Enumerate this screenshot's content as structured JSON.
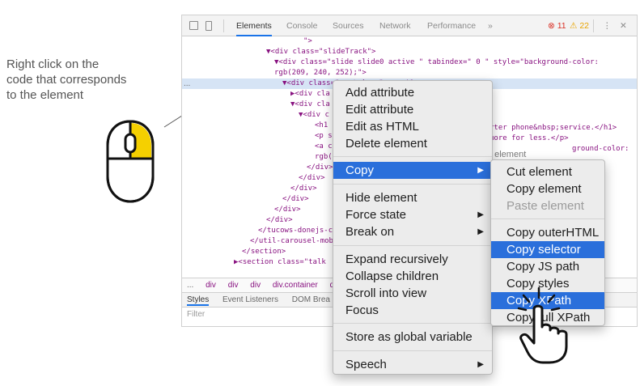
{
  "instruction": {
    "lines": [
      "Right click on the",
      "code that corresponds",
      "to the element"
    ]
  },
  "devtools": {
    "tabs": [
      "Elements",
      "Console",
      "Sources",
      "Network",
      "Performance"
    ],
    "more_tabs": "»",
    "error_count": "11",
    "warning_count": "22",
    "kebab": "⋮",
    "close": "✕",
    "code_lines": [
      "\">",
      "▼<div class=\"slideTrack\">",
      "▼<div class=\"slide slide0  active \" tabindex=\" 0 \" style=\"background-color:",
      "rgb(209, 240, 252);\">",
      "▼<div class=\"container\"> == $0",
      "▶<div cla",
      "▼<div cla",
      "▼<div c",
      "<h1",
      "<p s",
      "<a c",
      "rgb(",
      "</div>",
      "</div>",
      "</div>",
      "</div>",
      "</div>",
      "</div>",
      "</tucows-donejs-c",
      "</util-carousel-mob",
      "</section>",
      "▶<section class=\"talk"
    ],
    "right_fragments": [
      "rter phone&nbsp;service.</h1>",
      "more for less.</p>",
      "t element",
      "ground-color:"
    ],
    "selected_prefix": "...",
    "breadcrumbs": [
      "...",
      "div",
      "div",
      "div",
      "div.container",
      "div"
    ],
    "bottom_tabs": [
      "Styles",
      "Event Listeners",
      "DOM Brea"
    ],
    "filter_placeholder": "Filter"
  },
  "context_menu": {
    "items": [
      {
        "label": "Add attribute"
      },
      {
        "label": "Edit attribute"
      },
      {
        "label": "Edit as HTML"
      },
      {
        "label": "Delete element"
      },
      {
        "label": "Copy",
        "submenu": true,
        "highlighted": true
      },
      {
        "label": "Hide element"
      },
      {
        "label": "Force state",
        "submenu": true
      },
      {
        "label": "Break on",
        "submenu": true
      },
      {
        "label": "Expand recursively"
      },
      {
        "label": "Collapse children"
      },
      {
        "label": "Scroll into view"
      },
      {
        "label": "Focus"
      },
      {
        "label": "Store as global variable"
      },
      {
        "label": "Speech",
        "submenu": true
      }
    ],
    "submenu_arrow": "▶"
  },
  "copy_submenu": {
    "items": [
      {
        "label": "Cut element"
      },
      {
        "label": "Copy element"
      },
      {
        "label": "Paste element",
        "disabled": true
      },
      {
        "label": "Copy outerHTML"
      },
      {
        "label": "Copy selector",
        "highlighted": true
      },
      {
        "label": "Copy JS path"
      },
      {
        "label": "Copy styles"
      },
      {
        "label": "Copy XPath",
        "highlighted": true
      },
      {
        "label": "Copy full XPath"
      }
    ]
  },
  "colors": {
    "highlight": "#2a6fdb",
    "selected_row": "#d6e4f5",
    "mouse_button": "#f5d000"
  },
  "icons": [
    "inspect-icon",
    "device-icon",
    "mouse-icon",
    "hand-pointer-icon"
  ]
}
